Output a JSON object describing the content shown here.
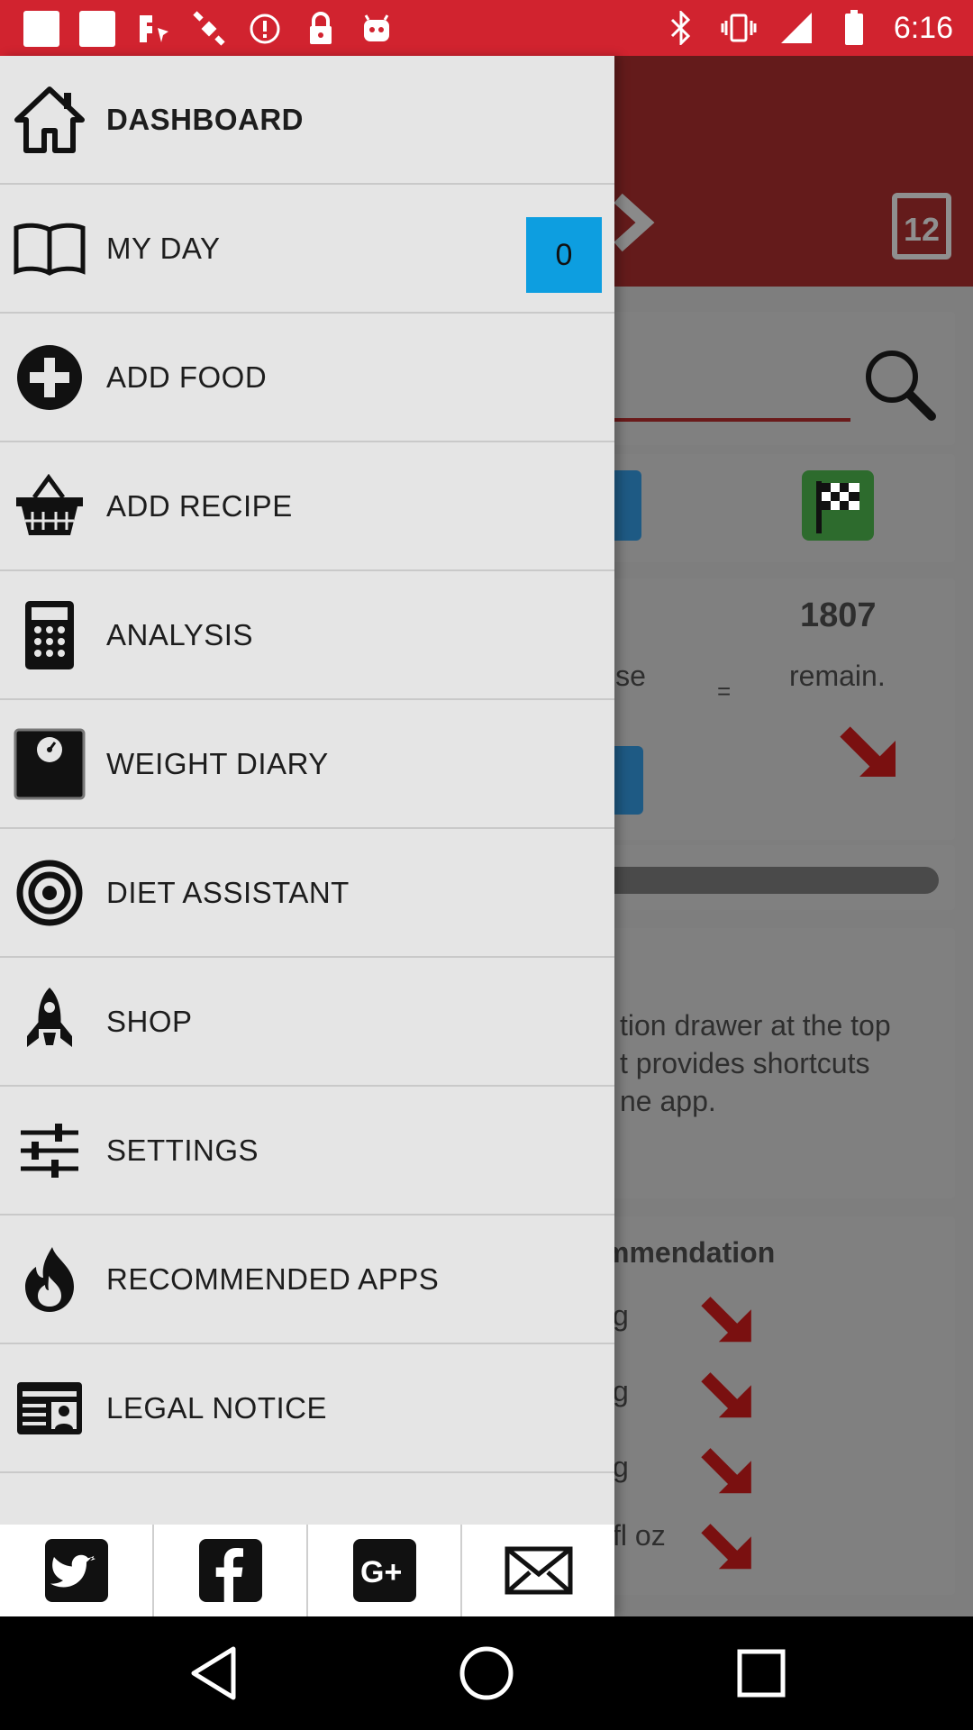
{
  "status_bar": {
    "time": "6:16",
    "left_icons": [
      "image-icon",
      "image-icon",
      "fake-gps-icon",
      "satellite-icon",
      "alert-icon",
      "lock-icon",
      "android-icon"
    ],
    "right_icons": [
      "bluetooth-icon",
      "vibrate-icon",
      "signal-icon",
      "battery-icon"
    ],
    "color": "#d1232f"
  },
  "background_app": {
    "calendar_day": "12",
    "calories_value": "1807",
    "exercise_fragment": "cise",
    "equals": "=",
    "remain_label": "remain.",
    "tip_lines": [
      "tion drawer at the top",
      "t provides shortcuts",
      "ne app."
    ],
    "recommendation_title": "mmendation",
    "rec_units": [
      "g",
      "g",
      "g",
      "fl oz"
    ],
    "header_color": "#641b1b"
  },
  "drawer": {
    "items": [
      {
        "label": "DASHBOARD",
        "icon": "home-icon",
        "bold": true
      },
      {
        "label": "MY DAY",
        "icon": "book-icon",
        "badge": "0"
      },
      {
        "label": "ADD FOOD",
        "icon": "plus-circle-icon"
      },
      {
        "label": "ADD RECIPE",
        "icon": "basket-icon"
      },
      {
        "label": "ANALYSIS",
        "icon": "calculator-icon"
      },
      {
        "label": "WEIGHT DIARY",
        "icon": "scale-icon"
      },
      {
        "label": "DIET ASSISTANT",
        "icon": "target-icon"
      },
      {
        "label": "SHOP",
        "icon": "rocket-icon"
      },
      {
        "label": "SETTINGS",
        "icon": "sliders-icon"
      },
      {
        "label": "RECOMMENDED APPS",
        "icon": "flame-icon"
      },
      {
        "label": "LEGAL NOTICE",
        "icon": "id-card-icon"
      }
    ],
    "badge_color": "#0d9ee0",
    "social": [
      {
        "name": "twitter",
        "icon": "twitter-icon"
      },
      {
        "name": "facebook",
        "icon": "facebook-icon"
      },
      {
        "name": "google-plus",
        "icon": "google-plus-icon"
      },
      {
        "name": "email",
        "icon": "mail-icon"
      }
    ]
  },
  "nav_bar": {
    "buttons": [
      "back-icon",
      "home-circle-icon",
      "recents-icon"
    ]
  }
}
